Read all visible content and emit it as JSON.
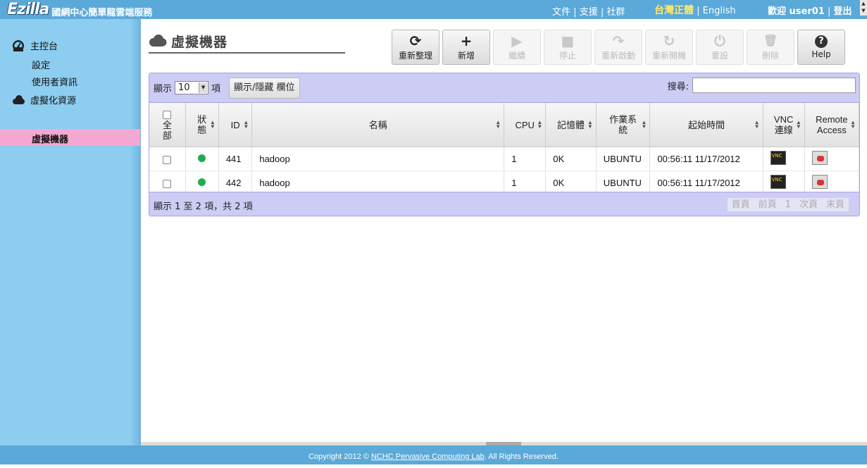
{
  "header": {
    "logo_text": "Ezilla",
    "site_title": "國網中心簡單龍雲端服務",
    "links": [
      "文件",
      "支援",
      "社群"
    ],
    "lang_current": "台灣正體",
    "lang_other": "English",
    "welcome": "歡迎 user01",
    "logout": "登出",
    "sep": "|"
  },
  "sidebar": {
    "dashboard": {
      "label": "主控台",
      "items": [
        "設定",
        "使用者資訊"
      ]
    },
    "virtual": {
      "label": "虛擬化資源",
      "active_item": "虛擬機器"
    }
  },
  "page": {
    "title": "虛擬機器"
  },
  "toolbar": [
    {
      "label": "重新整理",
      "icon": "⟳",
      "disabled": false
    },
    {
      "label": "新增",
      "icon": "+",
      "disabled": false
    },
    {
      "label": "繼續",
      "icon": "▶",
      "disabled": true
    },
    {
      "label": "停止",
      "icon": "■",
      "disabled": true
    },
    {
      "label": "重新啟動",
      "icon": "↷",
      "disabled": true
    },
    {
      "label": "重新開機",
      "icon": "↻",
      "disabled": true
    },
    {
      "label": "重設",
      "icon": "⏻",
      "disabled": true
    },
    {
      "label": "刪除",
      "icon": "🗑",
      "disabled": true
    },
    {
      "label": "Help",
      "icon": "?",
      "disabled": false
    }
  ],
  "grid": {
    "show_label": "顯示",
    "page_size": "10",
    "items_label": "項",
    "colvis_label": "顯示/隱藏 欄位",
    "search_label": "搜尋:",
    "search_value": "",
    "columns": [
      "全部",
      "狀態",
      "ID",
      "名稱",
      "CPU",
      "記憶體",
      "作業系統",
      "起始時間",
      "VNC 連線",
      "Remote Access"
    ],
    "rows": [
      {
        "status_color": "#1cae4c",
        "id": "441",
        "name": "hadoop",
        "cpu": "1",
        "memory": "0K",
        "os": "UBUNTU",
        "start": "00:56:11 11/17/2012"
      },
      {
        "status_color": "#1cae4c",
        "id": "442",
        "name": "hadoop",
        "cpu": "1",
        "memory": "0K",
        "os": "UBUNTU",
        "start": "00:56:11 11/17/2012"
      }
    ],
    "info": "顯示 1 至 2 項，共 2 項",
    "pager": [
      "首頁",
      "前頁",
      "1",
      "次頁",
      "末頁"
    ]
  },
  "footer": {
    "prefix": "Copyright 2012 ©",
    "link": "NCHC Pervasive Computing Lab",
    "suffix": ". All Rights Reserved."
  }
}
